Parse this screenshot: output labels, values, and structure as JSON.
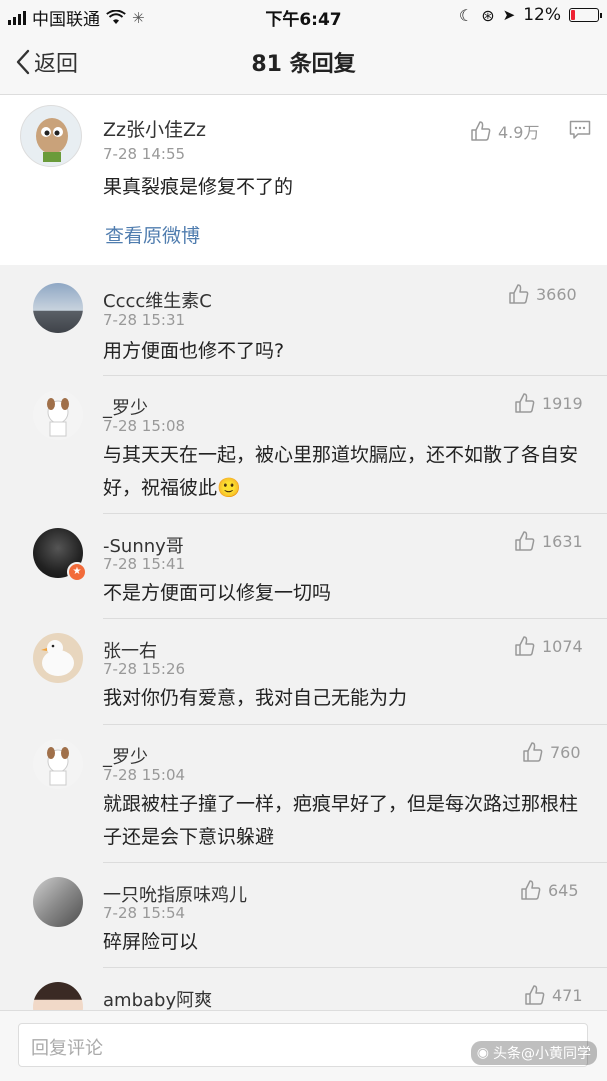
{
  "status_bar": {
    "carrier": "中国联通",
    "time": "下午6:47",
    "battery": "12%"
  },
  "nav": {
    "back_label": "返回",
    "title": "81 条回复"
  },
  "original": {
    "name": "Zz张小佳Zz",
    "time": "7-28 14:55",
    "text": "果真裂痕是修复不了的",
    "likes": "4.9万",
    "link": "查看原微博"
  },
  "replies": [
    {
      "name": "Cccc维生素C",
      "time": "7-28 15:31",
      "text": "用方便面也修不了吗?",
      "likes": "3660"
    },
    {
      "name": "_罗少",
      "time": "7-28 15:08",
      "text": "与其天天在一起，被心里那道坎膈应，还不如散了各自安好，祝福彼此🙂",
      "likes": "1919"
    },
    {
      "name": "-Sunny哥",
      "time": "7-28 15:41",
      "text": "不是方便面可以修复一切吗",
      "likes": "1631"
    },
    {
      "name": "张一右",
      "time": "7-28 15:26",
      "text": "我对你仍有爱意，我对自己无能为力",
      "likes": "1074"
    },
    {
      "name": "_罗少",
      "time": "7-28 15:04",
      "text": "就跟被柱子撞了一样，疤痕早好了，但是每次路过那根柱子还是会下意识躲避",
      "likes": "760"
    },
    {
      "name": "一只吮指原味鸡儿",
      "time": "7-28 15:54",
      "text": "碎屏险可以",
      "likes": "645"
    },
    {
      "name": "ambaby阿爽",
      "time": "",
      "text": "",
      "likes": "471"
    }
  ],
  "input": {
    "placeholder": "回复评论"
  },
  "watermark": {
    "text": "头条@小黄同学"
  }
}
